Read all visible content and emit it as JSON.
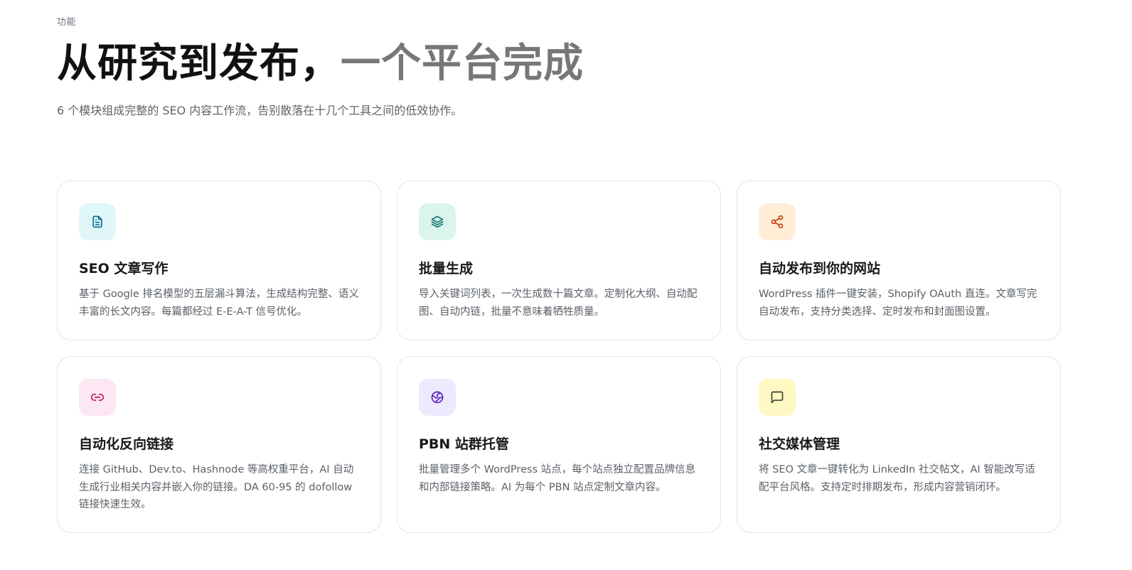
{
  "header": {
    "eyebrow": "功能",
    "headline_dark": "从研究到发布，",
    "headline_muted": "一个平台完成",
    "subhead": "6 个模块组成完整的 SEO 内容工作流，告别散落在十几个工具之间的低效协作。"
  },
  "features": [
    {
      "icon": "document-icon",
      "icon_bg": "#e0f7fa",
      "icon_color": "#0e7490",
      "title": "SEO 文章写作",
      "description": "基于 Google 排名模型的五层漏斗算法，生成结构完整、语义丰富的长文内容。每篇都经过 E-E-A-T 信号优化。"
    },
    {
      "icon": "layers-icon",
      "icon_bg": "#dcf5ec",
      "icon_color": "#0f766e",
      "title": "批量生成",
      "description": "导入关键词列表，一次生成数十篇文章。定制化大纲、自动配图、自动内链，批量不意味着牺牲质量。"
    },
    {
      "icon": "share-icon",
      "icon_bg": "#ffedd5",
      "icon_color": "#c2410c",
      "title": "自动发布到你的网站",
      "description": "WordPress 插件一键安装，Shopify OAuth 直连。文章写完自动发布，支持分类选择、定时发布和封面图设置。"
    },
    {
      "icon": "link-icon",
      "icon_bg": "#fce7f3",
      "icon_color": "#be185d",
      "title": "自动化反向链接",
      "description": "连接 GitHub、Dev.to、Hashnode 等高权重平台，AI 自动生成行业相关内容并嵌入你的链接。DA 60-95 的 dofollow 链接快速生效。"
    },
    {
      "icon": "globe-icon",
      "icon_bg": "#ede9fe",
      "icon_color": "#5b21b6",
      "title": "PBN 站群托管",
      "description": "批量管理多个 WordPress 站点，每个站点独立配置品牌信息和内部链接策略。AI 为每个 PBN 站点定制文章内容。"
    },
    {
      "icon": "chat-icon",
      "icon_bg": "#fef9c3",
      "icon_color": "#44403c",
      "title": "社交媒体管理",
      "description": "将 SEO 文章一键转化为 LinkedIn 社交帖文，AI 智能改写适配平台风格。支持定时排期发布，形成内容营销闭环。"
    }
  ]
}
